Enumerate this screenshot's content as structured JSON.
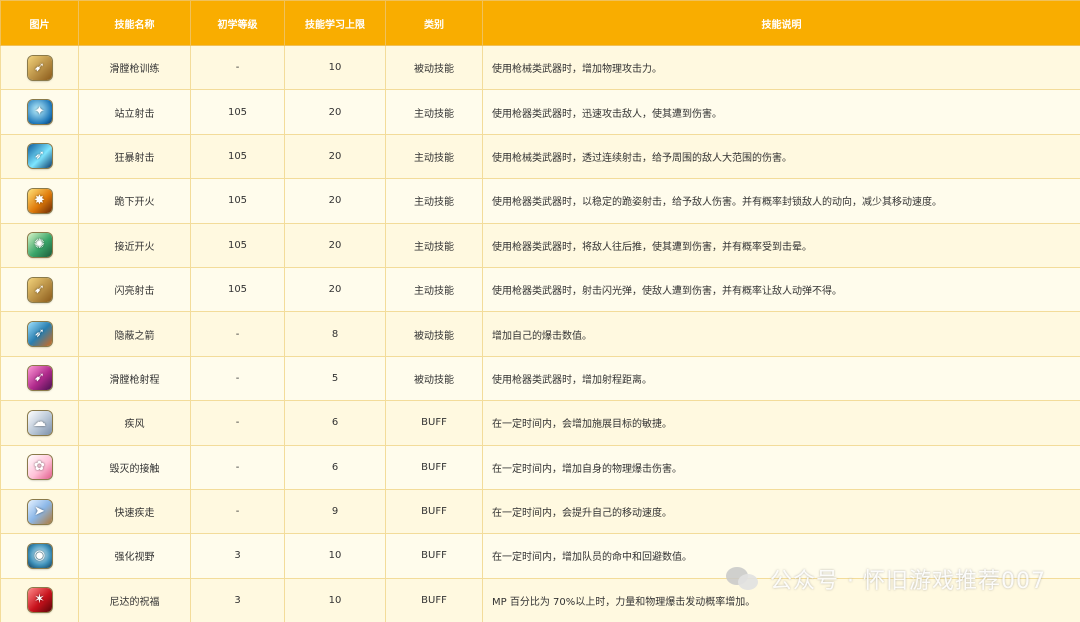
{
  "headers": {
    "image": "图片",
    "name": "技能名称",
    "level": "初学等级",
    "max": "技能学习上限",
    "type": "类别",
    "desc": "技能说明"
  },
  "rows": [
    {
      "icon": "rifle-training-icon",
      "name": "滑膛枪训练",
      "level": "-",
      "max": "10",
      "type": "被动技能",
      "desc": "使用枪械类武器时，增加物理攻击力。"
    },
    {
      "icon": "standing-shot-icon",
      "name": "站立射击",
      "level": "105",
      "max": "20",
      "type": "主动技能",
      "desc": "使用枪器类武器时，迅速攻击敌人，使其遭到伤害。"
    },
    {
      "icon": "frenzy-shot-icon",
      "name": "狂暴射击",
      "level": "105",
      "max": "20",
      "type": "主动技能",
      "desc": "使用枪械类武器时，透过连续射击，给予周围的敌人大范围的伤害。"
    },
    {
      "icon": "kneel-fire-icon",
      "name": "跪下开火",
      "level": "105",
      "max": "20",
      "type": "主动技能",
      "desc": "使用枪器类武器时，以稳定的跪姿射击，给予敌人伤害。并有概率封锁敌人的动向，减少其移动速度。"
    },
    {
      "icon": "close-fire-icon",
      "name": "接近开火",
      "level": "105",
      "max": "20",
      "type": "主动技能",
      "desc": "使用枪器类武器时，将敌人往后推，使其遭到伤害，并有概率受到击晕。"
    },
    {
      "icon": "flash-shot-icon",
      "name": "闪亮射击",
      "level": "105",
      "max": "20",
      "type": "主动技能",
      "desc": "使用枪器类武器时，射击闪光弹，使敌人遭到伤害，并有概率让敌人动弹不得。"
    },
    {
      "icon": "hidden-arrow-icon",
      "name": "隐蔽之箭",
      "level": "-",
      "max": "8",
      "type": "被动技能",
      "desc": "增加自己的爆击数值。"
    },
    {
      "icon": "rifle-range-icon",
      "name": "滑膛枪射程",
      "level": "-",
      "max": "5",
      "type": "被动技能",
      "desc": "使用枪器类武器时，增加射程距离。"
    },
    {
      "icon": "gale-icon",
      "name": "疾风",
      "level": "-",
      "max": "6",
      "type": "BUFF",
      "desc": "在一定时间内，会增加施展目标的敏捷。"
    },
    {
      "icon": "destroy-touch-icon",
      "name": "毁灭的接触",
      "level": "-",
      "max": "6",
      "type": "BUFF",
      "desc": "在一定时间内，增加自身的物理爆击伤害。"
    },
    {
      "icon": "quick-dash-icon",
      "name": "快速疾走",
      "level": "-",
      "max": "9",
      "type": "BUFF",
      "desc": "在一定时间内，会提升自己的移动速度。"
    },
    {
      "icon": "enhanced-vision-icon",
      "name": "强化视野",
      "level": "3",
      "max": "10",
      "type": "BUFF",
      "desc": "在一定时间内，增加队员的命中和回避数值。"
    },
    {
      "icon": "nida-blessing-icon",
      "name": "尼达的祝福",
      "level": "3",
      "max": "10",
      "type": "BUFF",
      "desc": "MP 百分比为 70%以上时，力量和物理爆击发动概率增加。"
    }
  ],
  "watermark": {
    "text": "公众号 · 怀旧游戏推荐007",
    "icon": "wechat-icon"
  },
  "colors": {
    "header_bg": "#f9ad00",
    "row_bg": "#fff9e0",
    "border": "#f3dc9a"
  }
}
